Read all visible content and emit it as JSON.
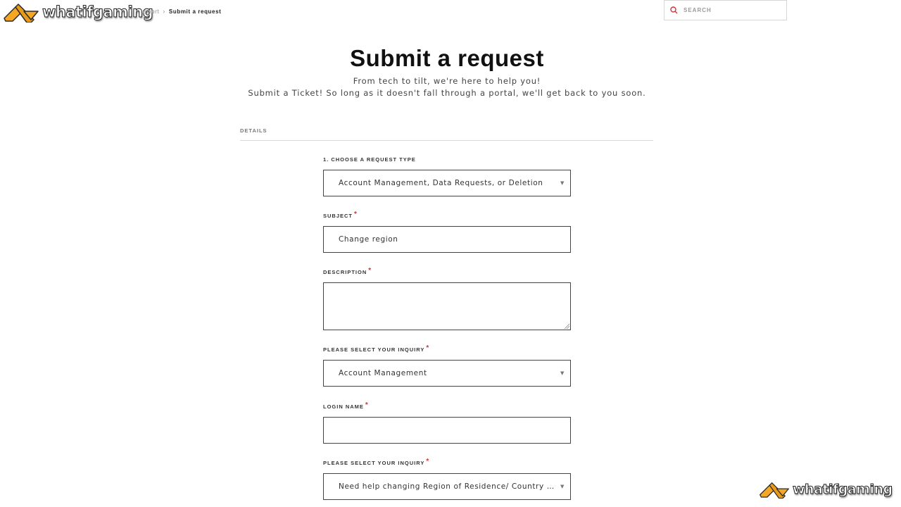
{
  "brand": {
    "name": "whatifgaming",
    "accent_color": "#f5a623"
  },
  "breadcrumb": {
    "items": [
      {
        "label": "upport",
        "current": false
      },
      {
        "label": "Submit a request",
        "current": true
      }
    ],
    "separator": "›"
  },
  "search": {
    "placeholder": "SEARCH",
    "icon": "search-icon",
    "icon_color": "#d0353d"
  },
  "header": {
    "title": "Submit a request",
    "subtitle_1": "From tech to tilt, we're here to help you!",
    "subtitle_2": "Submit a Ticket! So long as it doesn't fall through a portal, we'll get back to you soon."
  },
  "section": {
    "label": "DETAILS"
  },
  "form": {
    "required_marker": "*",
    "required_color": "#d0353d",
    "fields": [
      {
        "label": "1. CHOOSE A REQUEST TYPE",
        "type": "select",
        "value": "Account Management, Data Requests, or Deletion",
        "required": false
      },
      {
        "label": "SUBJECT",
        "type": "text",
        "value": "Change region",
        "required": true
      },
      {
        "label": "DESCRIPTION",
        "type": "textarea",
        "value": "",
        "required": true
      },
      {
        "label": "PLEASE SELECT YOUR INQUIRY",
        "type": "select",
        "value": "Account Management",
        "required": true
      },
      {
        "label": "LOGIN NAME",
        "type": "text",
        "value": "",
        "required": true
      },
      {
        "label": "PLEASE SELECT YOUR INQUIRY",
        "type": "select",
        "value": "Need help changing Region of Residence/ Country assi...",
        "required": true
      }
    ],
    "caret_glyph": "▼"
  }
}
